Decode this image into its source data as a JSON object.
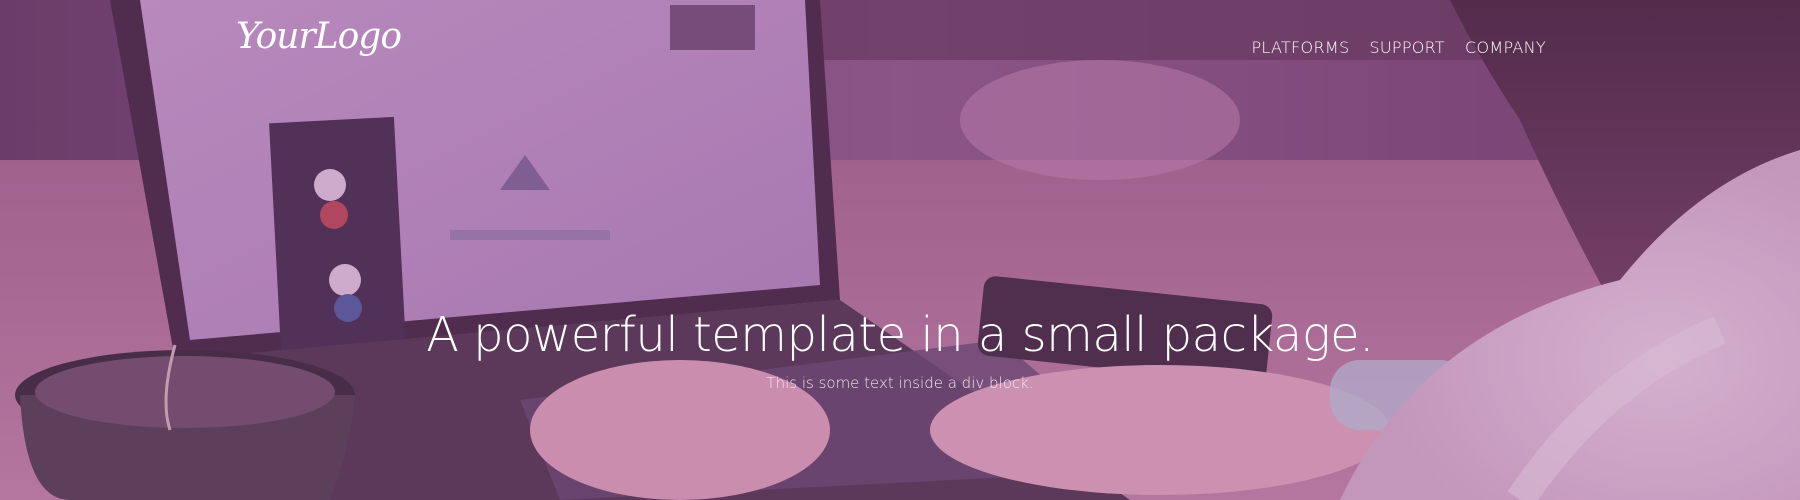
{
  "logo": {
    "text": "YourLogo"
  },
  "nav": {
    "items": [
      {
        "label": "PLATFORMS"
      },
      {
        "label": "SUPPORT"
      },
      {
        "label": "COMPANY"
      }
    ]
  },
  "hero": {
    "heading": "A powerful template in a small package.",
    "subtext": "This is some text inside a div block."
  },
  "colors": {
    "overlay": "#8c468c",
    "text": "#ffffff"
  }
}
